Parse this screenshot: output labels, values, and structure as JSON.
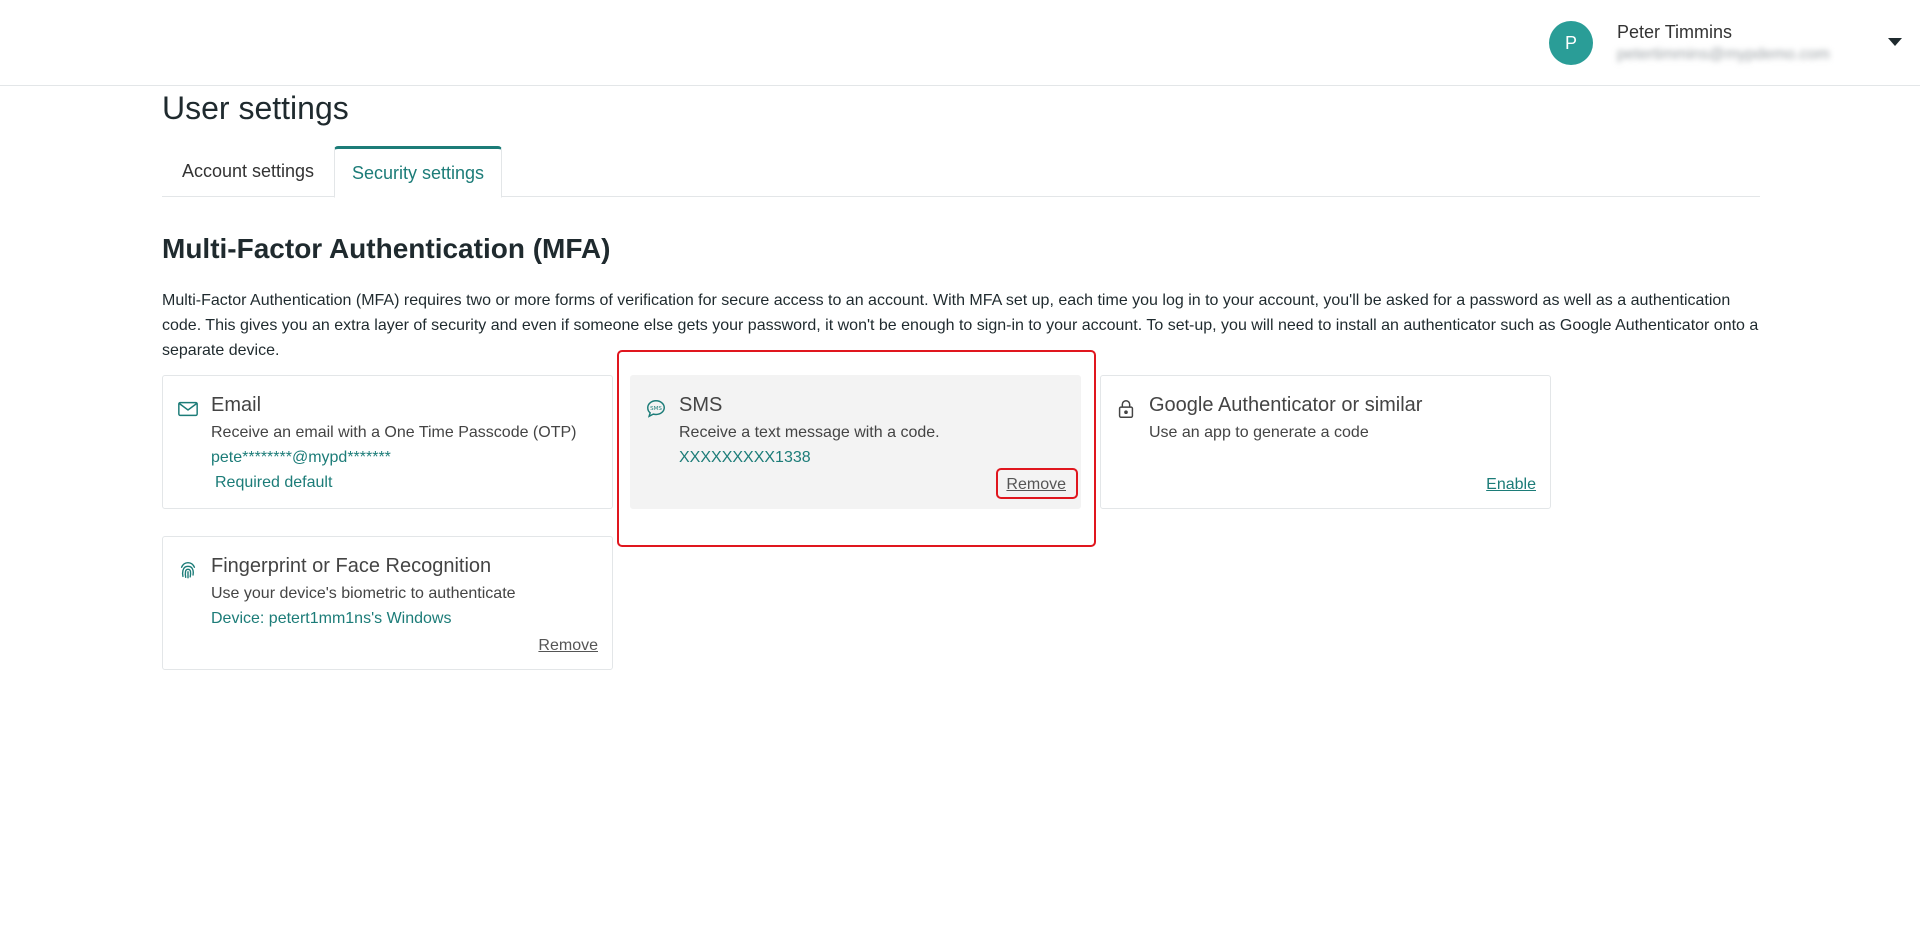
{
  "header": {
    "avatar_initial": "P",
    "user_name": "Peter Timmins",
    "user_email": "petertimmins@mypdemo.com",
    "menu_icon": "caret-down-icon"
  },
  "page": {
    "title": "User settings"
  },
  "tabs": [
    {
      "label": "Account settings",
      "active": false
    },
    {
      "label": "Security settings",
      "active": true
    }
  ],
  "mfa": {
    "heading": "Multi-Factor Authentication (MFA)",
    "description": "Multi-Factor Authentication (MFA) requires two or more forms of verification for secure access to an account. With MFA set up, each time you log in to your account, you'll be asked for a password as well as a authentication code. This gives you an extra layer of security and even if someone else gets your password, it won't be enough to sign-in to your account. To set-up, you will need to install an authenticator such as Google Authenticator onto a separate device.",
    "methods": {
      "email": {
        "icon": "envelope-icon",
        "title": "Email",
        "description": "Receive an email with a One Time Passcode (OTP)",
        "value": "pete********@mypd*******",
        "badge": "Required default"
      },
      "sms": {
        "icon": "sms-bubble-icon",
        "title": "SMS",
        "description": "Receive a text message with a code.",
        "value": "XXXXXXXXX1338",
        "action": "Remove"
      },
      "google": {
        "icon": "lock-icon",
        "title": "Google Authenticator or similar",
        "description": "Use an app to generate a code",
        "action": "Enable"
      },
      "fingerprint": {
        "icon": "fingerprint-icon",
        "title": "Fingerprint or Face Recognition",
        "description": "Use your device's biometric to authenticate",
        "value": "Device: petert1mm1ns's Windows",
        "action": "Remove"
      }
    }
  },
  "colors": {
    "accent": "#1c7c78",
    "avatar": "#2a9d97",
    "annotation": "#e0161e",
    "card_highlight": "#f3f3f3"
  }
}
